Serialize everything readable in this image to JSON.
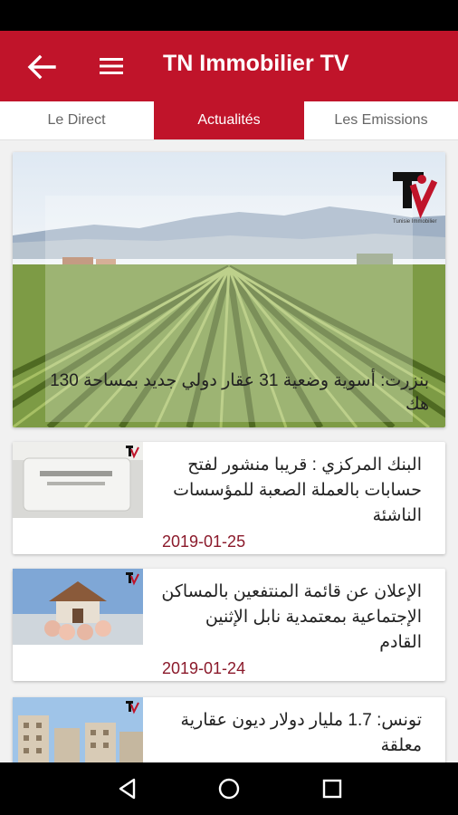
{
  "app": {
    "title": "TN Immobilier TV"
  },
  "tabs": [
    {
      "label": "Le Direct",
      "active": false
    },
    {
      "label": "Actualités",
      "active": true
    },
    {
      "label": "Les Emissions",
      "active": false
    }
  ],
  "featured": {
    "caption": "بنزرت: أسوية وضعية 31 عقار دولي جديد بمساحة 130 هك",
    "logo_text": "Tunisie Immobilier"
  },
  "news": [
    {
      "title": "البنك المركزي : قريبا منشور لفتح حسابات بالعملة الصعبة للمؤسسات الناشئة",
      "date": "2019-01-25"
    },
    {
      "title": "الإعلان عن قائمة المنتفعين بالمساكن الإجتماعية بمعتمدية نابل الإثنين القادم",
      "date": "2019-01-24"
    },
    {
      "title": "تونس: 1.7 مليار دولار ديون عقارية معلقة",
      "date": ""
    }
  ],
  "colors": {
    "primary": "#c0142a",
    "date": "#8b1a2b"
  },
  "icons": {
    "back": "arrow-left",
    "menu": "hamburger",
    "nav": [
      "back-triangle",
      "home-circle",
      "recents-square"
    ]
  }
}
